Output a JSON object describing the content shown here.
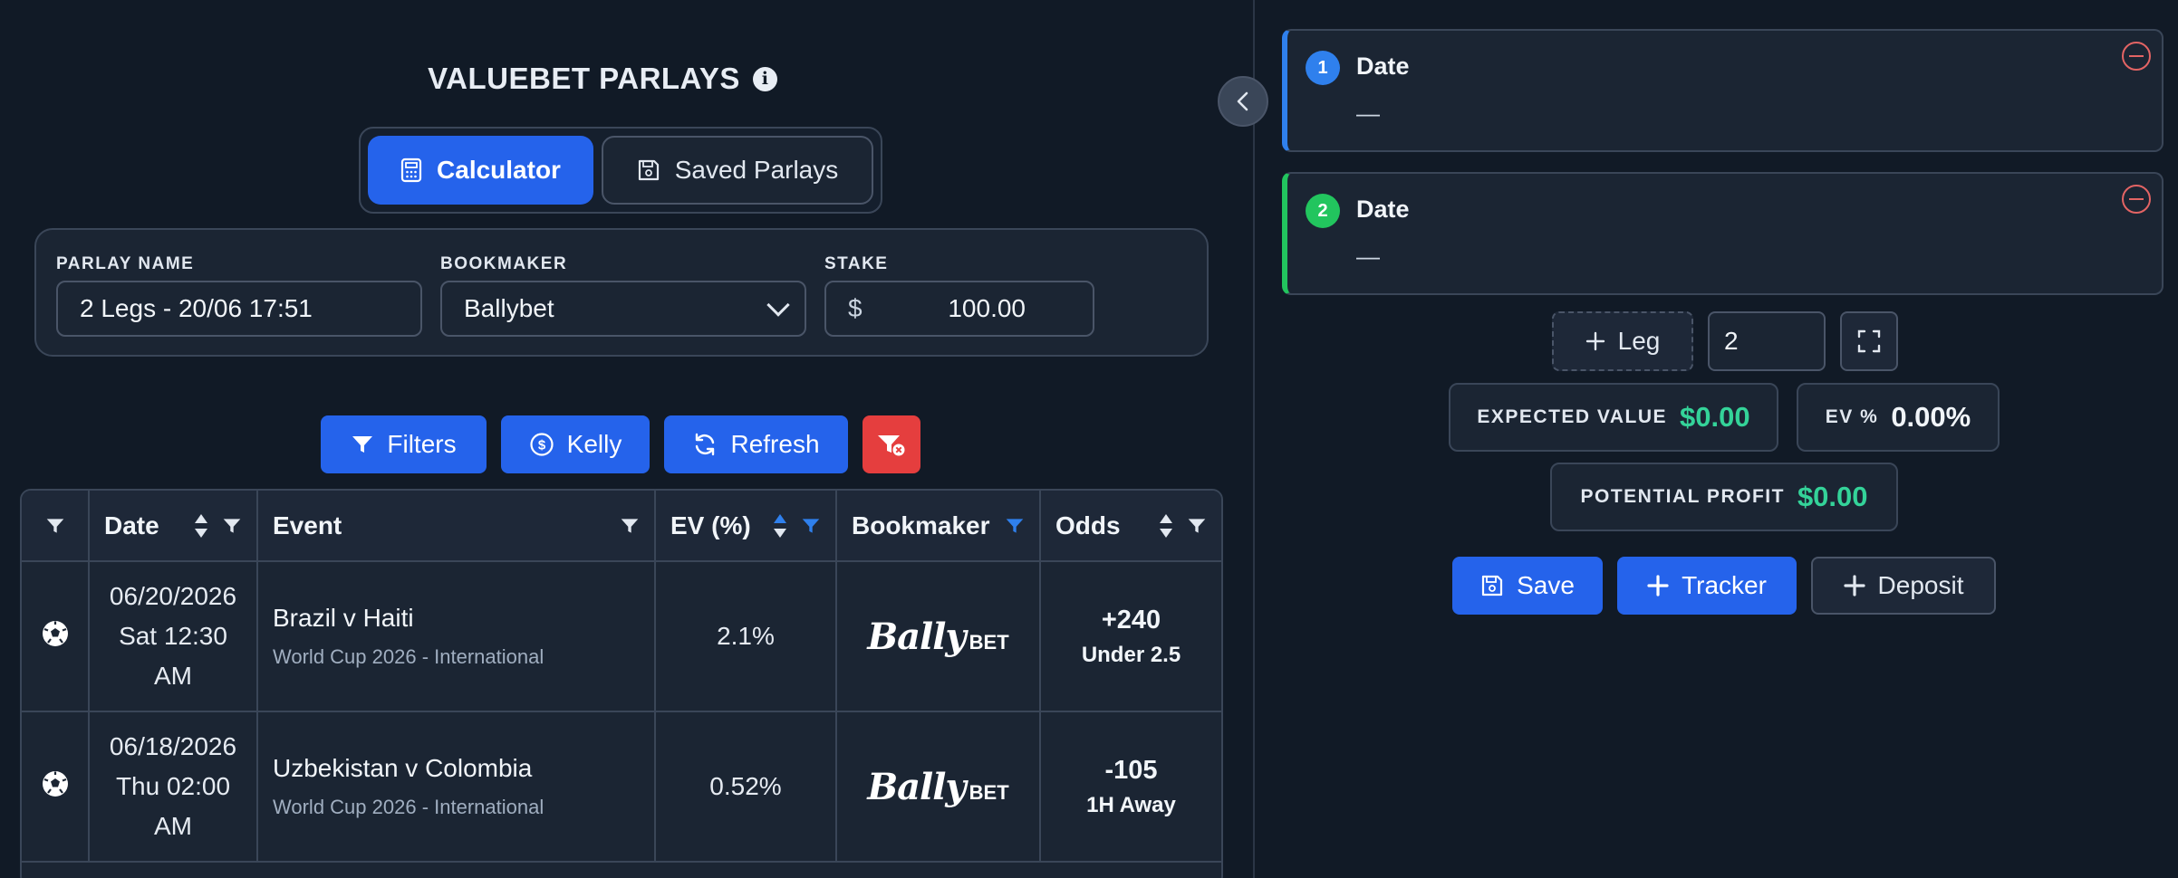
{
  "header": {
    "title": "VALUEBET PARLAYS"
  },
  "tabs": [
    {
      "label": "Calculator",
      "active": true
    },
    {
      "label": "Saved Parlays",
      "active": false
    }
  ],
  "form": {
    "parlay_name_label": "PARLAY NAME",
    "parlay_name_value": "2 Legs - 20/06 17:51",
    "bookmaker_label": "BOOKMAKER",
    "bookmaker_value": "Ballybet",
    "stake_label": "STAKE",
    "stake_currency": "$",
    "stake_value": "100.00"
  },
  "actions": {
    "filters": "Filters",
    "kelly": "Kelly",
    "refresh": "Refresh"
  },
  "table": {
    "headers": [
      "Date",
      "Event",
      "EV (%)",
      "Bookmaker",
      "Odds"
    ],
    "rows": [
      {
        "date_line1": "06/20/2026",
        "date_line2": "Sat 12:30",
        "date_line3": "AM",
        "event": "Brazil v Haiti",
        "league": "World Cup 2026 - International",
        "ev": "2.1%",
        "bookmaker_logo": "Bally",
        "bookmaker_logo_suffix": "BET",
        "odds": "+240",
        "market": "Under 2.5"
      },
      {
        "date_line1": "06/18/2026",
        "date_line2": "Thu 02:00",
        "date_line3": "AM",
        "event": "Uzbekistan v Colombia",
        "league": "World Cup 2026 - International",
        "ev": "0.52%",
        "bookmaker_logo": "Bally",
        "bookmaker_logo_suffix": "BET",
        "odds": "-105",
        "market": "1H Away"
      }
    ]
  },
  "legs": [
    {
      "number": "1",
      "title": "Date",
      "value": "—",
      "accent": "#2f80ed"
    },
    {
      "number": "2",
      "title": "Date",
      "value": "—",
      "accent": "#22c55e"
    }
  ],
  "leg_controls": {
    "add_label": "Leg",
    "count": "2"
  },
  "stats": {
    "expected_value_label": "EXPECTED VALUE",
    "expected_value": "$0.00",
    "ev_pct_label": "EV %",
    "ev_pct": "0.00%",
    "potential_profit_label": "POTENTIAL PROFIT",
    "potential_profit": "$0.00"
  },
  "bottom_actions": {
    "save": "Save",
    "tracker": "Tracker",
    "deposit": "Deposit"
  },
  "colors": {
    "primary": "#2563eb",
    "danger": "#e53e3e",
    "positive": "#34d399",
    "background": "#111a26"
  }
}
